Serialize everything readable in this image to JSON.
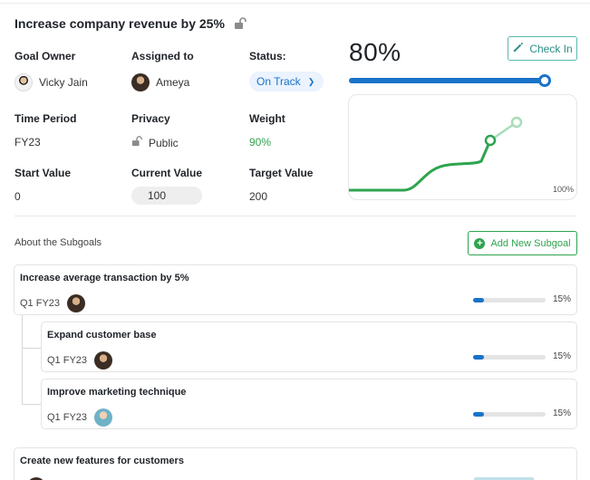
{
  "goal": {
    "title": "Increase company revenue by 25%",
    "lock_icon": "lock-open-icon"
  },
  "fields": {
    "goal_owner": {
      "label": "Goal Owner",
      "value": "Vicky Jain"
    },
    "assigned_to": {
      "label": "Assigned to",
      "value": "Ameya"
    },
    "status": {
      "label": "Status:",
      "value": "On Track",
      "color": "#1a73c9"
    },
    "time_period": {
      "label": "Time Period",
      "value": "FY23"
    },
    "privacy": {
      "label": "Privacy",
      "value": "Public"
    },
    "weight": {
      "label": "Weight",
      "value": "90%",
      "color": "#2ea44f"
    },
    "start_value": {
      "label": "Start Value",
      "value": "0"
    },
    "current_value": {
      "label": "Current Value",
      "value": "100"
    },
    "target_value": {
      "label": "Target Value",
      "value": "200"
    }
  },
  "progress": {
    "percent_label": "80%",
    "fraction": 0.98,
    "chart_max_label": "100%"
  },
  "checkin": {
    "label": "Check In",
    "icon": "pencil-icon"
  },
  "subgoals": {
    "heading": "About the Subgoals",
    "add_label": "Add New Subgoal",
    "items": [
      {
        "title": "Increase average transaction by 5%",
        "period": "Q1 FY23",
        "percent": "15%",
        "fraction": 0.15
      },
      {
        "title": "Expand customer base",
        "period": "Q1 FY23",
        "percent": "15%",
        "fraction": 0.15
      },
      {
        "title": "Improve marketing technique",
        "period": "Q1 FY23",
        "percent": "15%",
        "fraction": 0.15
      },
      {
        "title": "Create new features for customers",
        "period": "",
        "percent": "",
        "fraction": 0
      }
    ]
  },
  "colors": {
    "accent_blue": "#1a73c9",
    "accent_green": "#2ea44f",
    "teal": "#2a8f87"
  }
}
